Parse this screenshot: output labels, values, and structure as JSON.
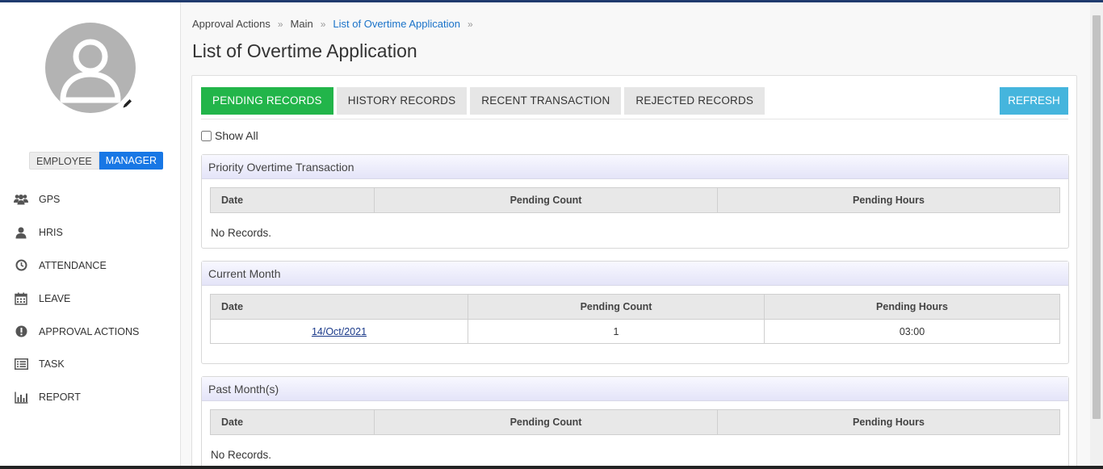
{
  "sidebar": {
    "role_toggle": {
      "employee": "EMPLOYEE",
      "manager": "MANAGER"
    },
    "items": [
      {
        "label": "GPS",
        "icon": "users-icon"
      },
      {
        "label": "HRIS",
        "icon": "user-icon"
      },
      {
        "label": "ATTENDANCE",
        "icon": "clock-icon"
      },
      {
        "label": "LEAVE",
        "icon": "calendar-icon"
      },
      {
        "label": "APPROVAL ACTIONS",
        "icon": "exclamation-circle-icon"
      },
      {
        "label": "TASK",
        "icon": "list-icon"
      },
      {
        "label": "REPORT",
        "icon": "bar-chart-icon"
      }
    ]
  },
  "breadcrumb": [
    "Approval Actions",
    "Main",
    "List of Overtime Application"
  ],
  "page_title": "List of Overtime Application",
  "tabs": [
    "PENDING RECORDS",
    "HISTORY RECORDS",
    "RECENT TRANSACTION",
    "REJECTED RECORDS"
  ],
  "refresh_label": "REFRESH",
  "show_all_label": "Show All",
  "columns": {
    "date": "Date",
    "count": "Pending Count",
    "hours": "Pending Hours"
  },
  "priority": {
    "title": "Priority Overtime Transaction",
    "empty": "No Records."
  },
  "current": {
    "title": "Current Month",
    "rows": [
      {
        "date": "14/Oct/2021",
        "count": "1",
        "hours": "03:00"
      }
    ]
  },
  "past": {
    "title": "Past Month(s)",
    "empty": "No Records."
  },
  "colors": {
    "accent_green": "#22b54a",
    "refresh_blue": "#45b5dd",
    "manager_blue": "#1877e5",
    "link_blue": "#1a73c9"
  }
}
